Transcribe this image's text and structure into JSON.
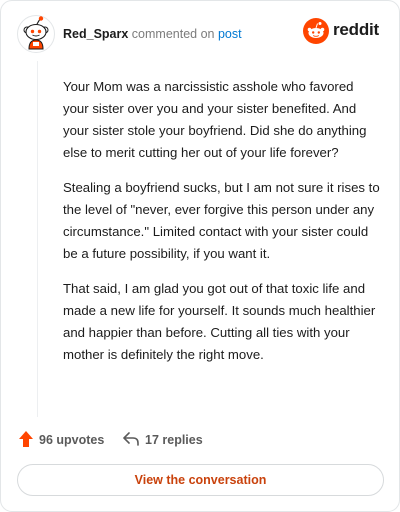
{
  "header": {
    "username": "Red_Sparx",
    "action_text": "commented on",
    "link_text": "post",
    "avatar_icon": "snoo-avatar-icon",
    "brand_name": "reddit",
    "brand_icon": "reddit-alien-icon"
  },
  "comment": {
    "paragraphs": [
      "Your Mom was a narcissistic asshole who favored your sister over you and your sister benefited. And your sister stole your boyfriend. Did she do anything else to merit cutting her out of your life forever?",
      "Stealing a boyfriend sucks, but I am not sure it rises to the level of \"never, ever forgive this person under any circumstance.\" Limited contact with your sister could be a future possibility, if you want it.",
      "That said, I am glad you got out of that toxic life and made a new life for yourself. It sounds much healthier and happier than before. Cutting all ties with your mother is definitely the right move."
    ]
  },
  "actions": {
    "upvotes_label": "96 upvotes",
    "upvote_icon": "upvote-arrow-icon",
    "replies_label": "17 replies",
    "reply_icon": "reply-arrow-icon"
  },
  "footer": {
    "button_label": "View the conversation"
  },
  "colors": {
    "brand_orange": "#ff4500",
    "link_blue": "#0079d3",
    "button_text": "#c9420c"
  }
}
